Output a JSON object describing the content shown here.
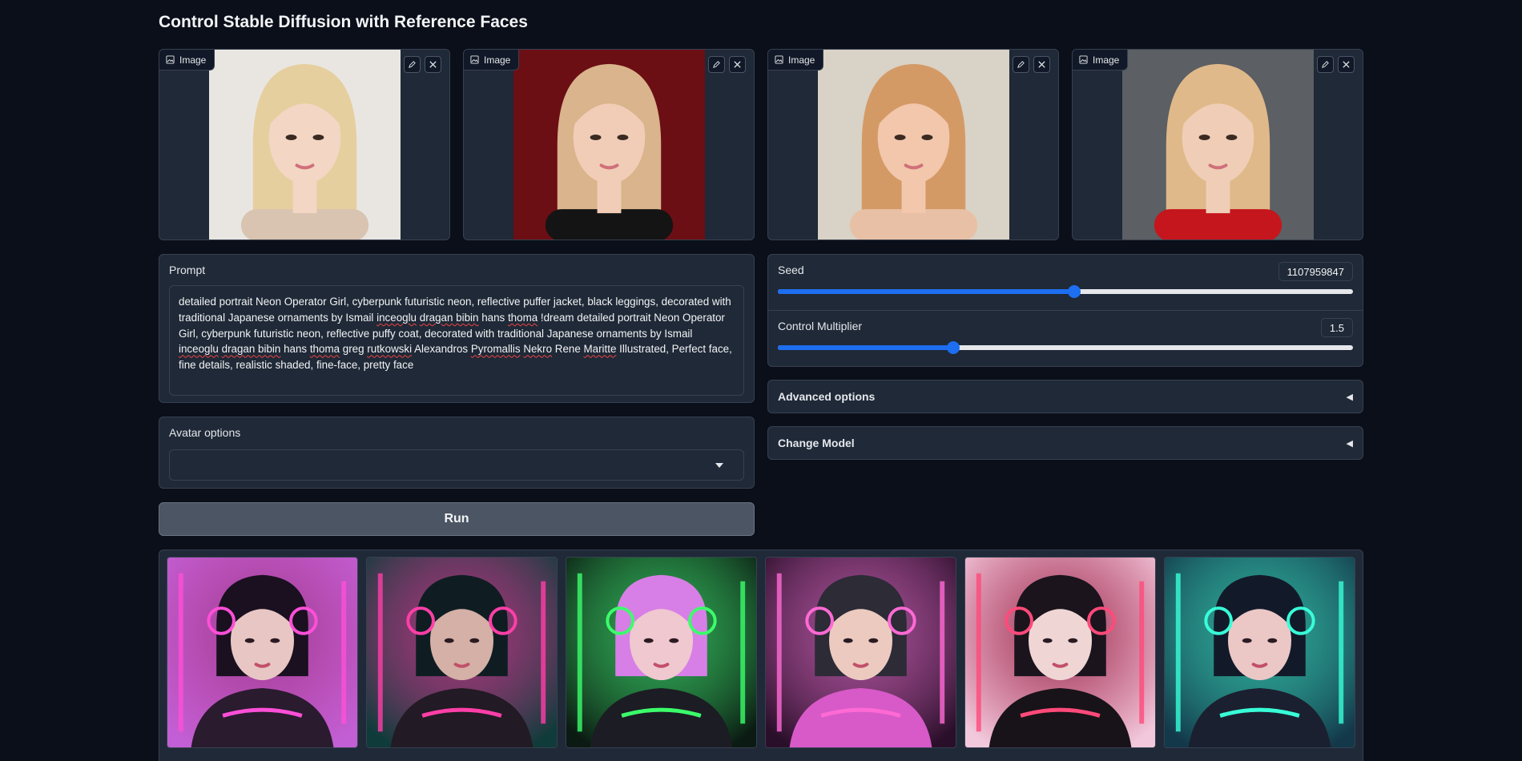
{
  "page": {
    "title": "Control Stable Diffusion with Reference Faces"
  },
  "reference_images": [
    {
      "label": "Image",
      "photo": "blonde-portrait-1",
      "bg": "#e9e6e2",
      "hair": "#e6cf9e",
      "skin": "#f3d6c4",
      "cloth": "#d8c4b0"
    },
    {
      "label": "Image",
      "photo": "blonde-portrait-2",
      "bg": "#6b0f14",
      "hair": "#d9b48c",
      "skin": "#f1cdb7",
      "cloth": "#141414"
    },
    {
      "label": "Image",
      "photo": "blonde-portrait-3",
      "bg": "#d9d2c6",
      "hair": "#d49a66",
      "skin": "#f2c7ac",
      "cloth": "#e8c0a6"
    },
    {
      "label": "Image",
      "photo": "blonde-portrait-4",
      "bg": "#5c5f63",
      "hair": "#e0b98a",
      "skin": "#f0cdb6",
      "cloth": "#c4161c"
    }
  ],
  "prompt": {
    "label": "Prompt",
    "text_parts": [
      "detailed portrait Neon Operator Girl, cyberpunk futuristic neon, reflective puffer jacket, black leggings, decorated with traditional Japanese ornaments by Ismail ",
      "inceoglu",
      " ",
      "dragan bibin",
      " hans ",
      "thoma",
      " !dream detailed portrait Neon Operator Girl, cyberpunk futuristic neon, reflective puffy coat, decorated with traditional Japanese ornaments by Ismail ",
      "inceoglu",
      " ",
      "dragan bibin",
      " hans ",
      "thoma",
      " greg ",
      "rutkowski",
      " Alexandros ",
      "Pyromallis",
      " ",
      "Nekro",
      " Rene ",
      "Maritte",
      " Illustrated, Perfect face, fine details, realistic shaded, fine-face, pretty face"
    ]
  },
  "avatar": {
    "label": "Avatar options",
    "value": ""
  },
  "run": {
    "label": "Run"
  },
  "seed": {
    "label": "Seed",
    "value": "1107959847",
    "fraction": 0.515
  },
  "control": {
    "label": "Control Multiplier",
    "value": "1.5",
    "fraction": 0.305
  },
  "advanced": {
    "label": "Advanced options",
    "icon": "triangle-left-icon"
  },
  "change_model": {
    "label": "Change Model",
    "icon": "triangle-left-icon"
  },
  "colors": {
    "accent": "#1d6ef0",
    "panel": "#1f2937",
    "background": "#0b0f19"
  },
  "gallery": [
    {
      "name": "neon-girl-1",
      "bg": "#c25fd4",
      "glow": "#ff4fd8",
      "hair": "#1a1020",
      "skin": "#e8c6c4",
      "jacket": "#2a1b2e"
    },
    {
      "name": "neon-girl-2",
      "bg": "#0f3b3a",
      "glow": "#ff3fa8",
      "hair": "#0f1d22",
      "skin": "#d4b0a6",
      "jacket": "#221a24"
    },
    {
      "name": "neon-girl-3",
      "bg": "#0b1a12",
      "glow": "#3bff6a",
      "hair": "#d77fe6",
      "skin": "#f0c8d0",
      "jacket": "#1c1c24"
    },
    {
      "name": "neon-girl-4",
      "bg": "#2a0f2a",
      "glow": "#ff6ad5",
      "hair": "#2c2b36",
      "skin": "#eccac0",
      "jacket": "#d75ac8"
    },
    {
      "name": "neon-girl-5",
      "bg": "#f2c9dc",
      "glow": "#ff4a7a",
      "hair": "#1b141d",
      "skin": "#efd6d4",
      "jacket": "#181318"
    },
    {
      "name": "neon-girl-6",
      "bg": "#13384a",
      "glow": "#38ffd8",
      "hair": "#121a2a",
      "skin": "#ebc7c6",
      "jacket": "#1b2030"
    }
  ]
}
